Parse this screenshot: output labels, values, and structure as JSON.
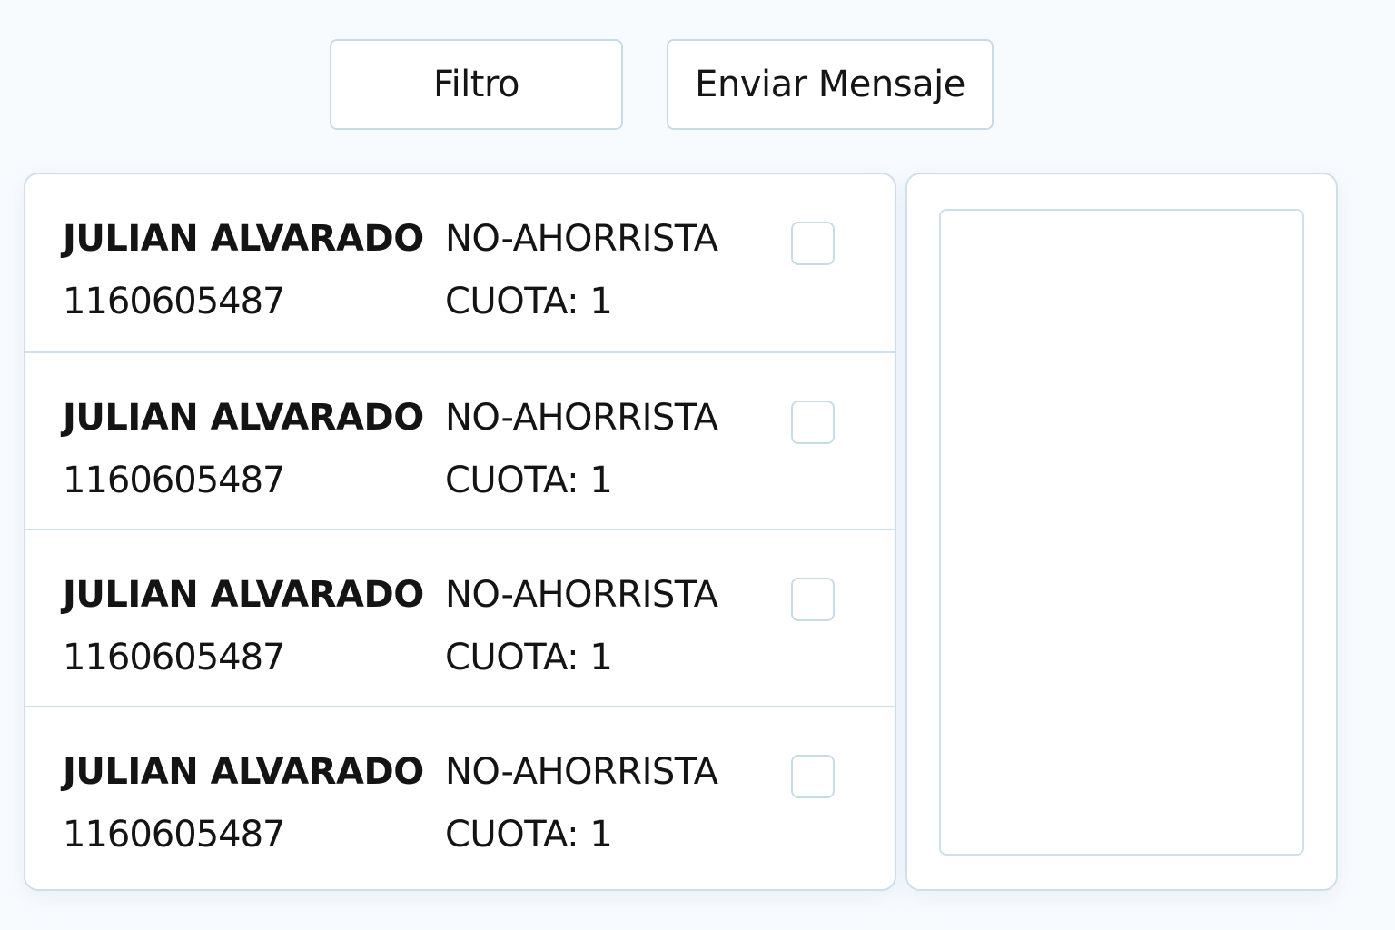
{
  "toolbar": {
    "filter_label": "Filtro",
    "send_label": "Enviar Mensaje"
  },
  "contacts": [
    {
      "name": "JULIAN ALVARADO",
      "phone": "1160605487",
      "type": "NO-AHORRISTA",
      "cuota": "CUOTA: 1",
      "checked": false
    },
    {
      "name": "JULIAN ALVARADO",
      "phone": "1160605487",
      "type": "NO-AHORRISTA",
      "cuota": "CUOTA: 1",
      "checked": false
    },
    {
      "name": "JULIAN ALVARADO",
      "phone": "1160605487",
      "type": "NO-AHORRISTA",
      "cuota": "CUOTA: 1",
      "checked": false
    },
    {
      "name": "JULIAN ALVARADO",
      "phone": "1160605487",
      "type": "NO-AHORRISTA",
      "cuota": "CUOTA: 1",
      "checked": false
    }
  ],
  "message": {
    "value": ""
  }
}
